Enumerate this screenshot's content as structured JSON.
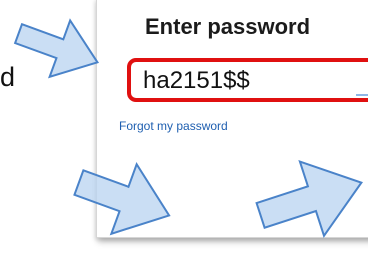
{
  "left_fragment": {
    "text": "d"
  },
  "login_card": {
    "heading": "Enter password",
    "password_value": "ha2151$$",
    "forgot_link": "Forgot my password"
  },
  "colors": {
    "highlight_border": "#e01010",
    "link": "#1f5fb0",
    "arrow_fill": "#b8d3f0",
    "arrow_stroke": "#4a83c9"
  },
  "icons": [
    "arrow-top-left-icon",
    "arrow-bottom-left-icon",
    "arrow-bottom-right-icon"
  ]
}
